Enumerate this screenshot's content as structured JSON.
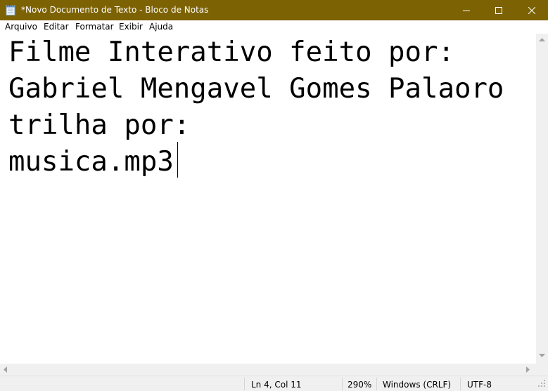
{
  "window": {
    "title": "*Novo Documento de Texto - Bloco de Notas",
    "title_bar_color": "#7c6203",
    "app_icon": "notepad-icon",
    "controls": {
      "minimize_icon": "minimize-icon",
      "maximize_icon": "maximize-icon",
      "close_icon": "close-icon"
    }
  },
  "menu": {
    "items": [
      "Arquivo",
      "Editar",
      "Formatar",
      "Exibir",
      "Ajuda"
    ]
  },
  "editor": {
    "lines": [
      "Filme Interativo feito por:",
      "Gabriel Mengavel Gomes Palaoro",
      "trilha por:",
      "musica.mp3"
    ]
  },
  "statusbar": {
    "cursor_position": "Ln 4, Col 11",
    "zoom": "290%",
    "line_ending": "Windows (CRLF)",
    "encoding": "UTF-8"
  }
}
